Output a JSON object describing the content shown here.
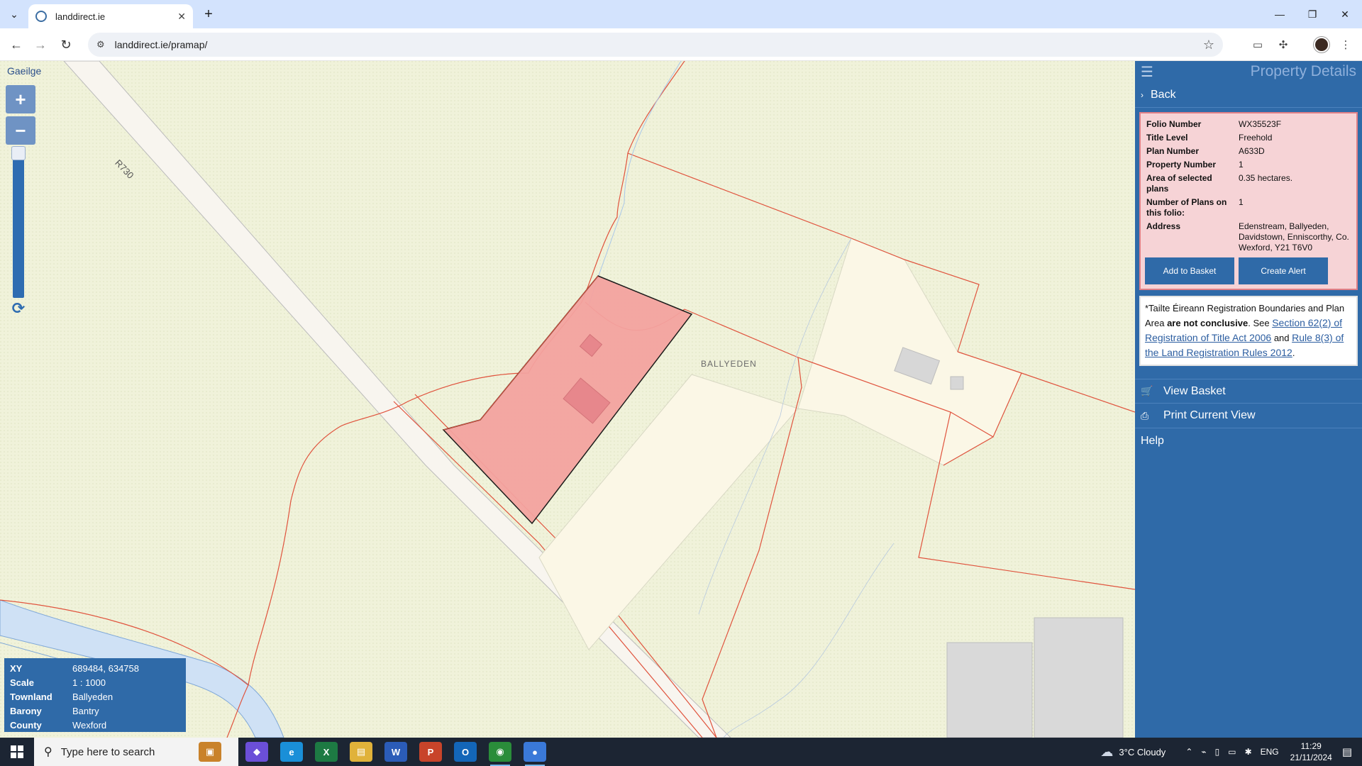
{
  "browser": {
    "tab_title": "landdirect.ie",
    "url": "landdirect.ie/pramap/"
  },
  "map": {
    "language_link": "Gaeilge",
    "zoom_in": "+",
    "zoom_out": "−",
    "road_label": "R730",
    "townland_label": "BALLYEDEN",
    "info": {
      "xy_label": "XY",
      "xy_value": "689484, 634758",
      "scale_label": "Scale",
      "scale_value": "1 : 1000",
      "townland_label": "Townland",
      "townland_value": "Ballyeden",
      "barony_label": "Barony",
      "barony_value": "Bantry",
      "county_label": "County",
      "county_value": "Wexford"
    }
  },
  "panel": {
    "title": "Property Details",
    "back": "Back",
    "details": {
      "folio_label": "Folio Number",
      "folio_value": "WX35523F",
      "title_level_label": "Title Level",
      "title_level_value": "Freehold",
      "plan_label": "Plan Number",
      "plan_value": "A633D",
      "property_label": "Property Number",
      "property_value": "1",
      "area_label": "Area of selected plans",
      "area_value": "0.35 hectares.",
      "plans_count_label": "Number of Plans on this folio:",
      "plans_count_value": "1",
      "address_label": "Address",
      "address_value": "Edenstream, Ballyeden, Davidstown, Enniscorthy, Co. Wexford, Y21 T6V0"
    },
    "add_basket": "Add to Basket",
    "create_alert": "Create Alert",
    "disclaimer": {
      "part1": "*Tailte Éireann Registration Boundaries and Plan Area ",
      "bold": "are not conclusive",
      "part2": ". See ",
      "link1": "Section 62(2) of Registration of Title Act 2006",
      "part3": " and ",
      "link2": "Rule 8(3) of the Land Registration Rules 2012",
      "part4": "."
    },
    "view_basket": "View Basket",
    "print_view": "Print Current View",
    "help": "Help"
  },
  "taskbar": {
    "search_placeholder": "Type here to search",
    "weather": "3°C  Cloudy",
    "language": "ENG",
    "time": "11:29",
    "date": "21/11/2024"
  },
  "colors": {
    "panel_blue": "#2f6aa8",
    "selected_parcel": "#f4a3a0",
    "boundary": "#e0533d",
    "map_bg": "#f0f2da"
  }
}
